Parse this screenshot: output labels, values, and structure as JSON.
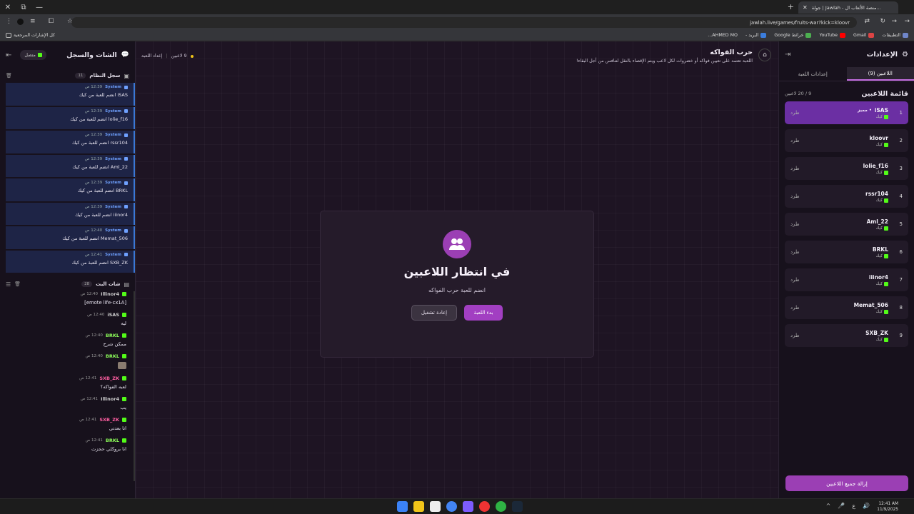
{
  "browser": {
    "tab_title": "جولة | Jawlah - منصة الألعاب ال...",
    "url": "jawlah.live/games/fruits-war?kick=kloovr",
    "bookmarks": [
      "التطبيقات",
      "Gmail",
      "YouTube",
      "خرائط Google",
      "البريد -",
      "AHMED MO..."
    ],
    "all_bookmarks": "كل الإشارات المرجعية"
  },
  "settings": {
    "title": "الإعدادات",
    "tab_players": "اللاعبين (9)",
    "tab_game": "إعدادات اللعبة",
    "list_title": "قائمة اللاعبين",
    "list_count": "9 / 20 لاعبين",
    "kick_label": "طرد",
    "platform_label": "كيك",
    "remove_all": "إزالة جميع اللاعبين",
    "players": [
      {
        "num": "1",
        "name": "iSAS",
        "badge": "• مميز"
      },
      {
        "num": "2",
        "name": "kloovr",
        "badge": ""
      },
      {
        "num": "3",
        "name": "lolie_f16",
        "badge": ""
      },
      {
        "num": "4",
        "name": "rssr104",
        "badge": ""
      },
      {
        "num": "5",
        "name": "Aml_22",
        "badge": ""
      },
      {
        "num": "6",
        "name": "BRKL",
        "badge": ""
      },
      {
        "num": "7",
        "name": "iiinor4",
        "badge": ""
      },
      {
        "num": "8",
        "name": "Memat_506",
        "badge": ""
      },
      {
        "num": "9",
        "name": "SXB_ZK",
        "badge": ""
      }
    ]
  },
  "game": {
    "title": "حرب الفواكه",
    "description": "اللعبة تعتمد على تعيين فواكه أو خضروات لكل لاعب ويتم الإقصاء بالنقل لتنافس من أجل البقاء!",
    "players_count": "9 لاعبين",
    "game_settings": "إعداد اللعبة",
    "wait_title": "في انتظار اللاعبين",
    "wait_sub": "انضم للعبة حرب الفواكه",
    "start": "بدء اللعبة",
    "restart": "إعادة تشغيل"
  },
  "chat": {
    "title": "الشات والسجل",
    "status": "متصل",
    "syslog_title": "سجل النظام",
    "syslog_count": "11",
    "system_name": "System",
    "system_messages": [
      {
        "time": "12:39 ص",
        "text": "iSAS انضم للعبة من كيك"
      },
      {
        "time": "12:39 ص",
        "text": "lolie_f16 انضم للعبة من كيك"
      },
      {
        "time": "12:39 ص",
        "text": "rssr104 انضم للعبة من كيك"
      },
      {
        "time": "12:39 ص",
        "text": "Aml_22 انضم للعبة من كيك"
      },
      {
        "time": "12:39 ص",
        "text": "BRKL انضم للعبة من كيك"
      },
      {
        "time": "12:39 ص",
        "text": "iiinor4 انضم للعبة من كيك"
      },
      {
        "time": "12:40 ص",
        "text": "Memat_506 انضم للعبة من كيك"
      },
      {
        "time": "12:41 ص",
        "text": "SXB_ZK انضم للعبة من كيك"
      }
    ],
    "live_title": "شات البث",
    "live_count": "28",
    "messages": [
      {
        "name": "Illinor4",
        "time": "12:40 ص",
        "text": "[emote life-cx1A]",
        "color": "#cfcfcf"
      },
      {
        "name": "iSAS",
        "time": "12:40 ص",
        "text": "ليه",
        "color": "#cfcfcf"
      },
      {
        "name": "BRKL",
        "time": "12:40 ص",
        "text": "ممكن شرح",
        "color": "#8dff5a"
      },
      {
        "name": "BRKL",
        "time": "12:40 ص",
        "text": "",
        "color": "#8dff5a"
      },
      {
        "name": "SXB_ZK",
        "time": "12:41 ص",
        "text": "لعبه الفواكه؟",
        "color": "#ff5fa2"
      },
      {
        "name": "Illinor4",
        "time": "12:41 ص",
        "text": "يب",
        "color": "#cfcfcf"
      },
      {
        "name": "SXB_ZK",
        "time": "12:41 ص",
        "text": "انا بعدني",
        "color": "#ff5fa2"
      },
      {
        "name": "BRKL",
        "time": "12:41 ص",
        "text": "انا بروكلي حجزت",
        "color": "#8dff5a"
      }
    ]
  },
  "taskbar": {
    "time": "12:41 AM",
    "date": "11/9/2025",
    "lang": "ع"
  },
  "colors": {
    "accent": "#9b3fb4",
    "kick_green": "#53fc18",
    "system_blue": "#3a78d6"
  }
}
